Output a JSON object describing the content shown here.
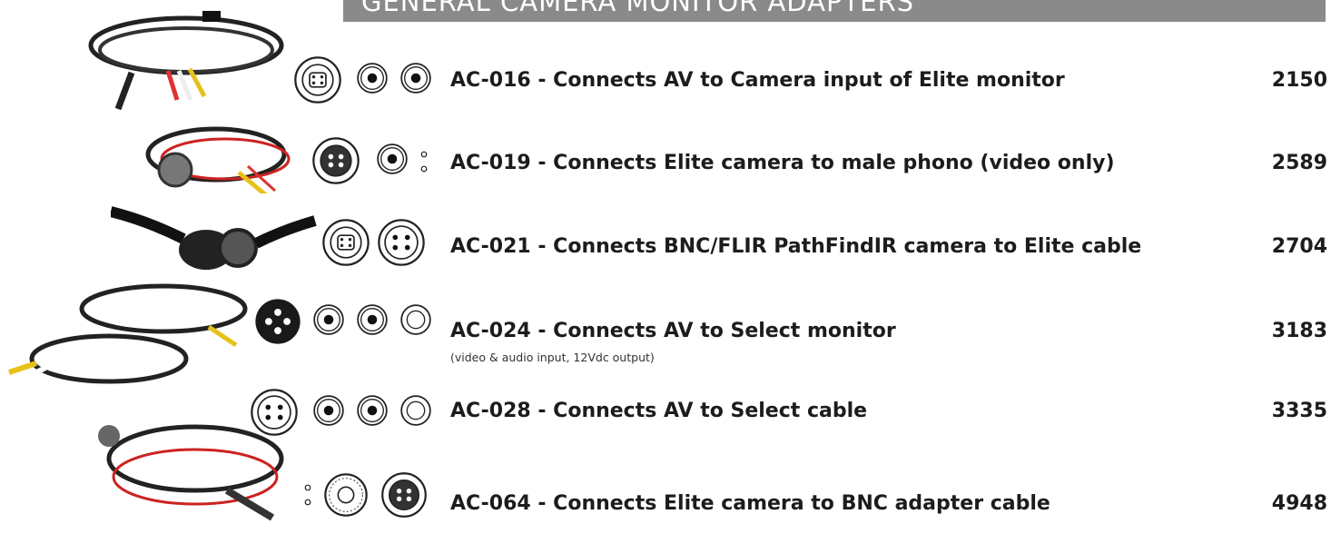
{
  "header": {
    "title": "GENERAL CAMERA MONITOR ADAPTERS"
  },
  "products": [
    {
      "code_title": "AC-016 - Connects AV to Camera input of Elite monitor",
      "subtitle": "",
      "price": "2150",
      "connectors": [
        "svideo-connector-icon",
        "rca-connector-icon",
        "rca-connector-icon"
      ]
    },
    {
      "code_title": "AC-019 - Connects Elite camera to male phono (video only)",
      "subtitle": "",
      "price": "2589",
      "connectors": [
        "elite-connector-icon",
        "rca-connector-icon",
        "pin-connector-icon"
      ]
    },
    {
      "code_title": "AC-021 - Connects BNC/FLIR PathFindIR camera to Elite cable",
      "subtitle": "",
      "price": "2704",
      "connectors": [
        "svideo-connector-icon",
        "four-pin-connector-icon"
      ]
    },
    {
      "code_title": "AC-024 - Connects AV to Select monitor",
      "subtitle": "(video & audio input, 12Vdc output)",
      "price": "3183",
      "connectors": [
        "select-connector-icon",
        "rca-connector-icon",
        "rca-connector-icon",
        "ring-connector-icon"
      ]
    },
    {
      "code_title": "AC-028 - Connects AV to Select cable",
      "subtitle": "",
      "price": "3335",
      "connectors": [
        "four-pin-connector-icon",
        "rca-connector-icon",
        "rca-connector-icon",
        "ring-connector-icon"
      ]
    },
    {
      "code_title": "AC-064 - Connects Elite camera to BNC adapter cable",
      "subtitle": "",
      "price": "4948",
      "connectors": [
        "pin-connector-icon",
        "bnc-connector-icon",
        "elite-connector-icon"
      ]
    }
  ]
}
